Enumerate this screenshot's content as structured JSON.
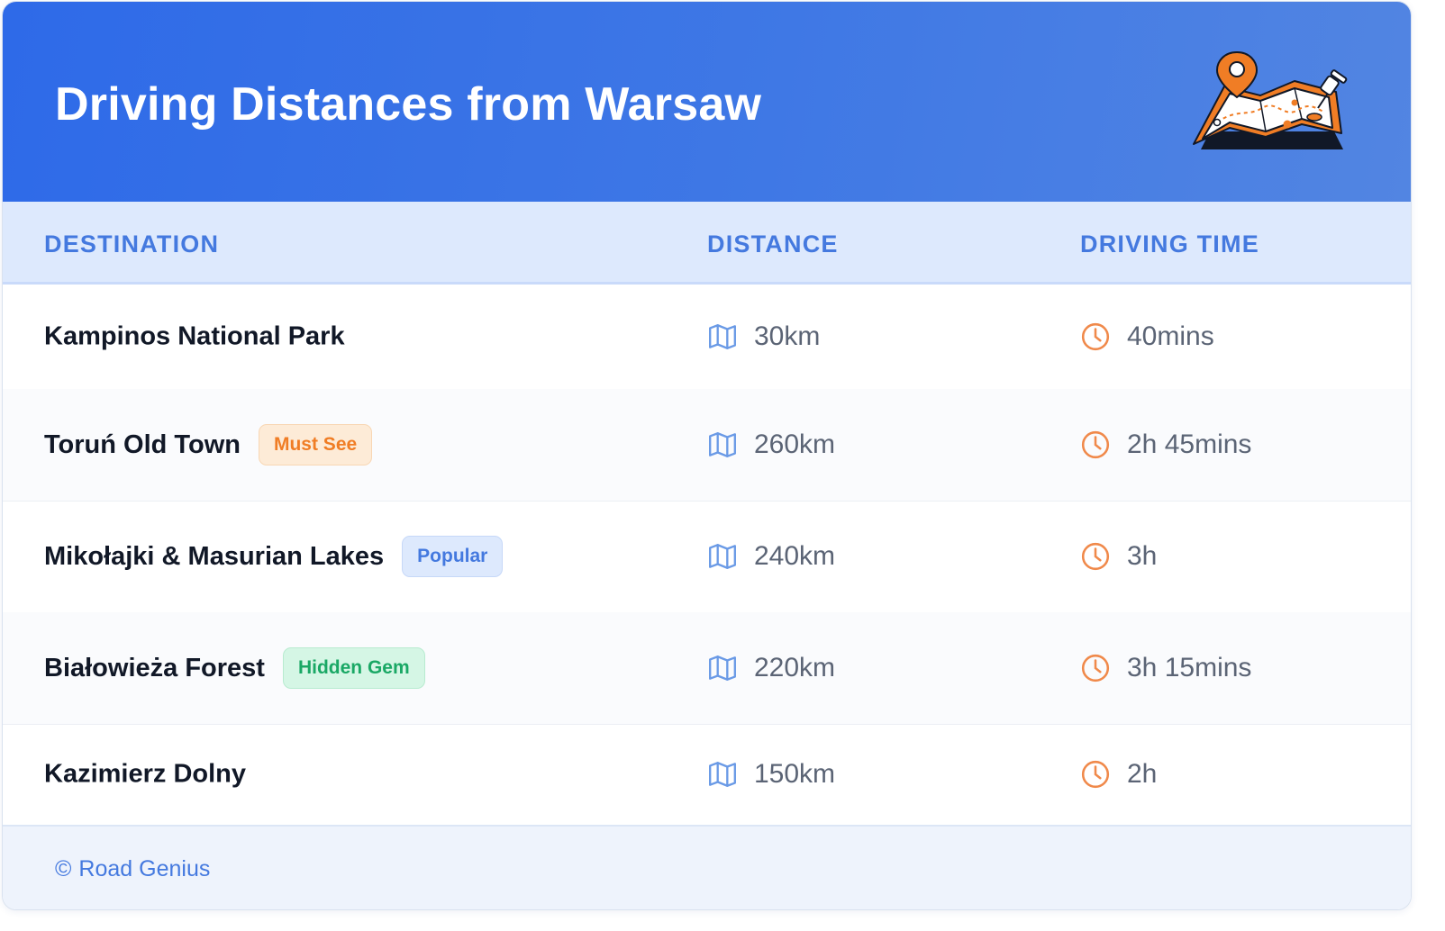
{
  "header": {
    "title": "Driving Distances from Warsaw"
  },
  "table": {
    "columns": [
      "DESTINATION",
      "DISTANCE",
      "DRIVING TIME"
    ],
    "rows": [
      {
        "destination": "Kampinos National Park",
        "badge": null,
        "distance": "30km",
        "time": "40mins"
      },
      {
        "destination": "Toruń Old Town",
        "badge": "Must See",
        "badge_color": "orange",
        "distance": "260km",
        "time": "2h 45mins"
      },
      {
        "destination": "Mikołajki & Masurian Lakes",
        "badge": "Popular",
        "badge_color": "blue",
        "distance": "240km",
        "time": "3h"
      },
      {
        "destination": "Białowieża Forest",
        "badge": "Hidden Gem",
        "badge_color": "green",
        "distance": "220km",
        "time": "3h 15mins"
      },
      {
        "destination": "Kazimierz Dolny",
        "badge": null,
        "distance": "150km",
        "time": "2h"
      }
    ]
  },
  "icons": {
    "distance": "map-icon",
    "time": "clock-icon",
    "header": "map-pin-illustration",
    "footer": "copyright-icon"
  },
  "footer": {
    "copyright_symbol": "©",
    "brand": "Road Genius"
  },
  "colors": {
    "header_start": "#2e6ae8",
    "header_end": "#5285e2",
    "accent_blue": "#4479df",
    "accent_orange": "#f07d25",
    "accent_green": "#1aa865"
  }
}
